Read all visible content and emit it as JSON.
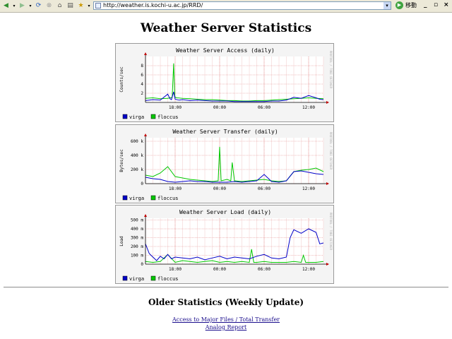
{
  "browser": {
    "address_url": "http://weather.is.kochi-u.ac.jp/RRD/",
    "go_label": "移動"
  },
  "page": {
    "title": "Weather Server Statistics",
    "older_heading": "Older Statistics (Weekly Update)",
    "links": [
      "Access to Major Files / Total Transfer",
      "Analog Report"
    ]
  },
  "side_text": "RRDTOOL / TOBI OETIKER",
  "chart_data": [
    {
      "type": "line",
      "title": "Weather Server Access (daily)",
      "ylabel": "Counts/sec",
      "yticks": [
        "2",
        "4",
        "6",
        "8"
      ],
      "ylim": [
        0,
        10
      ],
      "xticks": [
        "18:00",
        "00:00",
        "06:00",
        "12:00"
      ],
      "xlim_hours": [
        14,
        38
      ],
      "legend": [
        "virga",
        "floccus"
      ],
      "colors": {
        "virga": "#0000c8",
        "floccus": "#00c800"
      },
      "series": [
        {
          "name": "virga",
          "x": [
            14,
            15,
            16,
            17,
            17.3,
            17.5,
            17.8,
            18,
            18.5,
            19,
            20,
            21,
            22,
            23,
            24,
            25,
            26,
            27,
            28,
            29,
            30,
            31,
            32,
            33,
            34,
            35,
            36,
            37,
            37.5,
            38
          ],
          "values": [
            0.4,
            0.6,
            0.5,
            1.8,
            0.8,
            0.6,
            2.3,
            0.7,
            0.5,
            0.6,
            0.4,
            0.5,
            0.4,
            0.3,
            0.3,
            0.3,
            0.2,
            0.2,
            0.2,
            0.2,
            0.2,
            0.3,
            0.3,
            0.5,
            1.1,
            0.9,
            1.5,
            1.0,
            0.7,
            0.6
          ]
        },
        {
          "name": "floccus",
          "x": [
            14,
            15,
            16,
            17,
            17.6,
            17.8,
            17.95,
            18.2,
            19,
            20,
            21,
            22,
            23,
            24,
            25,
            26,
            27,
            28,
            29,
            30,
            31,
            32,
            33,
            34,
            35,
            36,
            37,
            38
          ],
          "values": [
            0.9,
            1.0,
            0.8,
            0.9,
            1.1,
            8.5,
            1.2,
            1.0,
            0.9,
            0.8,
            0.7,
            0.6,
            0.6,
            0.5,
            0.4,
            0.4,
            0.3,
            0.3,
            0.4,
            0.4,
            0.5,
            0.6,
            0.7,
            0.8,
            0.9,
            1.0,
            0.9,
            0.8
          ]
        }
      ]
    },
    {
      "type": "line",
      "title": "Weather Server Transfer (daily)",
      "ylabel": "Bytes/sec",
      "yticks": [
        "0",
        "200 k",
        "400 k",
        "600 k"
      ],
      "ylim": [
        0,
        650000
      ],
      "xticks": [
        "18:00",
        "00:00",
        "06:00",
        "12:00"
      ],
      "xlim_hours": [
        14,
        38
      ],
      "legend": [
        "virga",
        "floccus"
      ],
      "colors": {
        "virga": "#0000c8",
        "floccus": "#00c800"
      },
      "series": [
        {
          "name": "virga",
          "x": [
            14,
            15,
            16,
            17,
            18,
            19,
            20,
            21,
            22,
            23,
            24,
            25,
            26,
            27,
            28,
            29,
            30,
            31,
            32,
            33,
            34,
            35,
            36,
            37,
            38
          ],
          "values": [
            90000,
            70000,
            60000,
            30000,
            20000,
            30000,
            40000,
            30000,
            30000,
            20000,
            20000,
            20000,
            30000,
            20000,
            30000,
            40000,
            130000,
            30000,
            20000,
            40000,
            170000,
            180000,
            160000,
            140000,
            130000
          ]
        },
        {
          "name": "floccus",
          "x": [
            14,
            15,
            16,
            17,
            18,
            19,
            20,
            21,
            22,
            23,
            23.8,
            24,
            24.2,
            25,
            25.5,
            25.7,
            26,
            27,
            28,
            29,
            30,
            31,
            32,
            33,
            34,
            35,
            36,
            37,
            38
          ],
          "values": [
            120000,
            100000,
            150000,
            240000,
            100000,
            80000,
            60000,
            50000,
            40000,
            30000,
            40000,
            520000,
            40000,
            60000,
            40000,
            300000,
            40000,
            30000,
            40000,
            50000,
            60000,
            40000,
            30000,
            40000,
            170000,
            190000,
            200000,
            220000,
            170000
          ]
        }
      ]
    },
    {
      "type": "line",
      "title": "Weather Server Load (daily)",
      "ylabel": "Load",
      "yticks": [
        "0",
        "100 m",
        "200 m",
        "300 m",
        "400 m",
        "500 m"
      ],
      "ylim": [
        0,
        520
      ],
      "xticks": [
        "18:00",
        "00:00",
        "06:00",
        "12:00"
      ],
      "xlim_hours": [
        14,
        38
      ],
      "legend": [
        "virga",
        "floccus"
      ],
      "colors": {
        "virga": "#0000c8",
        "floccus": "#00c800"
      },
      "series": [
        {
          "name": "virga",
          "x": [
            14,
            14.5,
            15,
            15.5,
            16,
            16.5,
            17,
            17.5,
            18,
            19,
            20,
            21,
            22,
            23,
            24,
            25,
            26,
            27,
            28,
            29,
            30,
            31,
            32,
            33,
            33.5,
            34,
            35,
            36,
            37,
            37.5,
            38
          ],
          "values": [
            230,
            120,
            80,
            40,
            90,
            60,
            110,
            60,
            80,
            70,
            60,
            80,
            50,
            70,
            90,
            60,
            80,
            70,
            60,
            90,
            110,
            70,
            60,
            80,
            300,
            390,
            350,
            400,
            360,
            230,
            240
          ]
        },
        {
          "name": "floccus",
          "x": [
            14,
            15,
            16,
            17,
            18,
            19,
            20,
            21,
            22,
            23,
            24,
            25,
            26,
            27,
            28,
            28.3,
            28.6,
            29,
            30,
            31,
            32,
            33,
            34,
            35,
            35.3,
            35.6,
            36,
            37,
            38
          ],
          "values": [
            30,
            20,
            30,
            110,
            20,
            40,
            30,
            20,
            30,
            40,
            20,
            30,
            20,
            30,
            20,
            170,
            20,
            20,
            30,
            20,
            20,
            20,
            30,
            20,
            100,
            20,
            20,
            20,
            30
          ]
        }
      ]
    }
  ]
}
